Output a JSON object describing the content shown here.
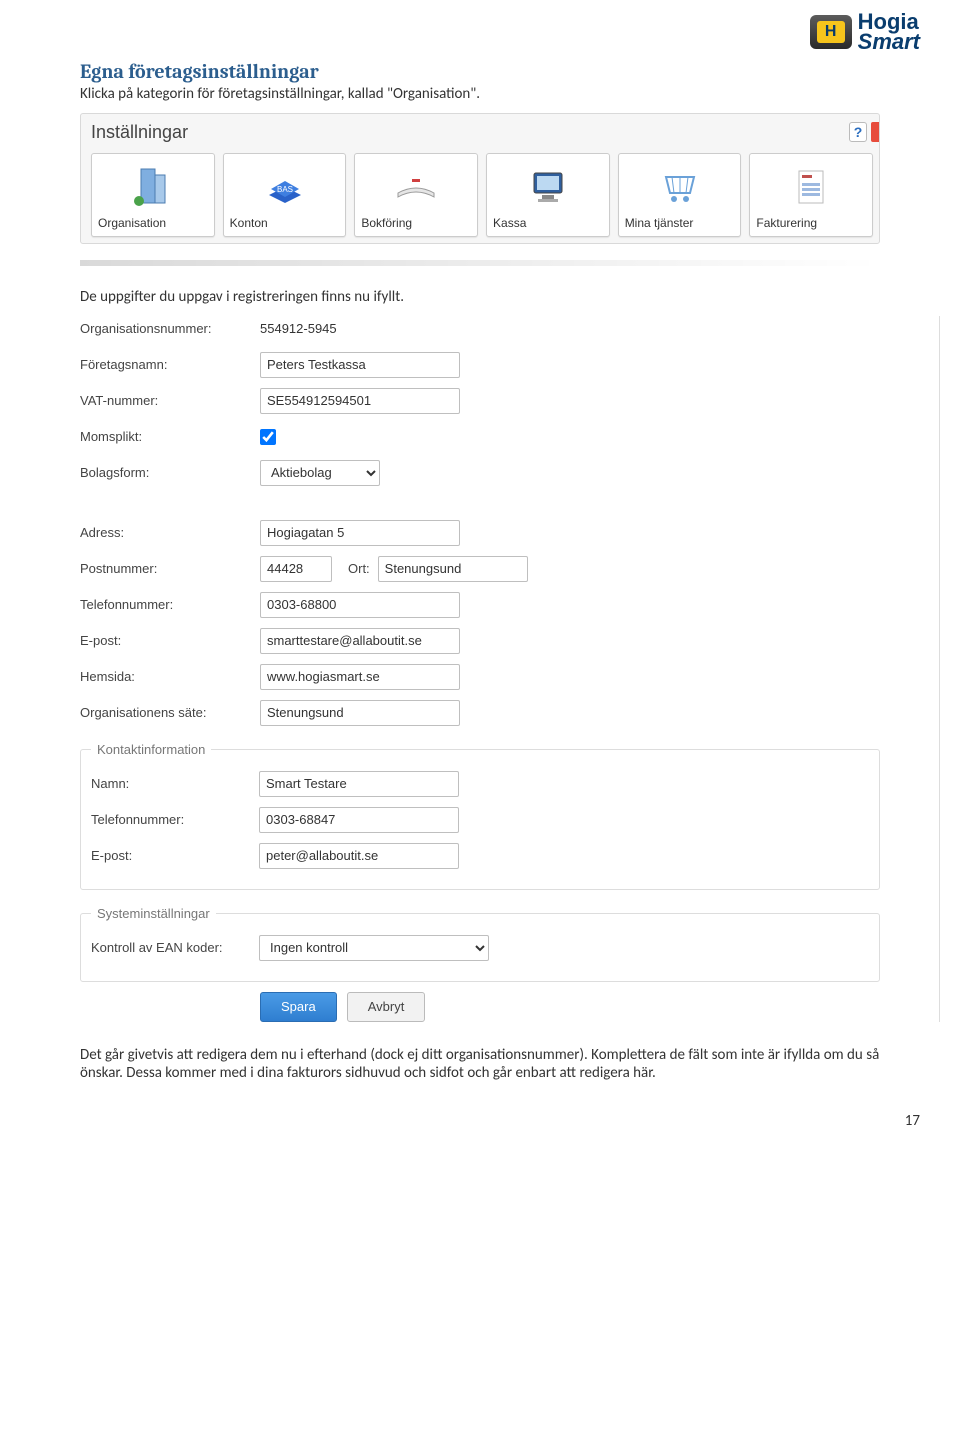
{
  "logo": {
    "brand_top": "Hogia",
    "brand_bot": "Smart",
    "letter": "H"
  },
  "heading": "Egna företagsinställningar",
  "intro": "Klicka på kategorin för företagsinställningar, kallad \"Organisation\".",
  "settings_panel": {
    "title": "Inställningar",
    "help": "?",
    "tiles": [
      {
        "label": "Organisation"
      },
      {
        "label": "Konton"
      },
      {
        "label": "Bokföring"
      },
      {
        "label": "Kassa"
      },
      {
        "label": "Mina tjänster"
      },
      {
        "label": "Fakturering"
      }
    ]
  },
  "para_after_panel": "De uppgifter du uppgav i registreringen finns nu ifyllt.",
  "form": {
    "org_no_label": "Organisationsnummer:",
    "org_no_value": "554912-5945",
    "company_label": "Företagsnamn:",
    "company_value": "Peters Testkassa",
    "vat_label": "VAT-nummer:",
    "vat_value": "SE554912594501",
    "moms_label": "Momsplikt:",
    "moms_checked": true,
    "bolag_label": "Bolagsform:",
    "bolag_value": "Aktiebolag",
    "adress_label": "Adress:",
    "adress_value": "Hogiagatan 5",
    "postnr_label": "Postnummer:",
    "postnr_value": "44428",
    "ort_label": "Ort:",
    "ort_value": "Stenungsund",
    "tel_label": "Telefonnummer:",
    "tel_value": "0303-68800",
    "epost_label": "E-post:",
    "epost_value": "smarttestare@allaboutit.se",
    "hemsida_label": "Hemsida:",
    "hemsida_value": "www.hogiasmart.se",
    "sate_label": "Organisationens säte:",
    "sate_value": "Stenungsund"
  },
  "kontakt_group": {
    "legend": "Kontaktinformation",
    "namn_label": "Namn:",
    "namn_value": "Smart Testare",
    "tel_label": "Telefonnummer:",
    "tel_value": "0303-68847",
    "epost_label": "E-post:",
    "epost_value": "peter@allaboutit.se"
  },
  "system_group": {
    "legend": "Systeminställningar",
    "ean_label": "Kontroll av EAN koder:",
    "ean_value": "Ingen kontroll"
  },
  "buttons": {
    "save": "Spara",
    "cancel": "Avbryt"
  },
  "outro": "Det går givetvis att redigera dem nu i efterhand (dock ej ditt organisationsnummer). Komplettera de fält som inte är ifyllda om du så önskar. Dessa kommer med i dina fakturors sidhuvud och sidfot och går enbart att redigera här.",
  "page_number": "17"
}
